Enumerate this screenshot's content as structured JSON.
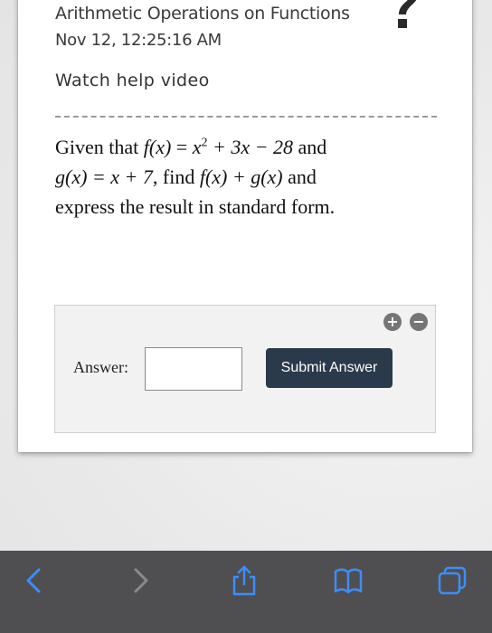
{
  "header": {
    "title": "Arithmetic Operations on Functions",
    "timestamp": "Nov 12, 12:25:16 AM",
    "help_link": "Watch help video",
    "help_icon": "question-mark-icon"
  },
  "question": {
    "p1": "Given that ",
    "f_lhs": "f(x)",
    "eq1": " = ",
    "x_base": "x",
    "x_exp": "2",
    "f_rest": " + 3x − 28",
    "and1": " and",
    "g_def": "g(x) = x + 7",
    "find": ", find ",
    "sum_expr": "f(x) + g(x)",
    "and2": " and",
    "tail": "express the result in standard form."
  },
  "answer": {
    "label": "Answer:",
    "input_value": "",
    "submit_label": "Submit Answer",
    "plus_icon": "plus-icon",
    "minus_icon": "minus-icon"
  },
  "browser_toolbar": {
    "background": "#4f4f51",
    "icons": [
      "back-arrow-icon",
      "forward-arrow-icon",
      "share-icon",
      "bookmarks-icon",
      "tabs-icon"
    ],
    "active_color": "#3d8ef7",
    "disabled_color": "#8a8a8e"
  }
}
